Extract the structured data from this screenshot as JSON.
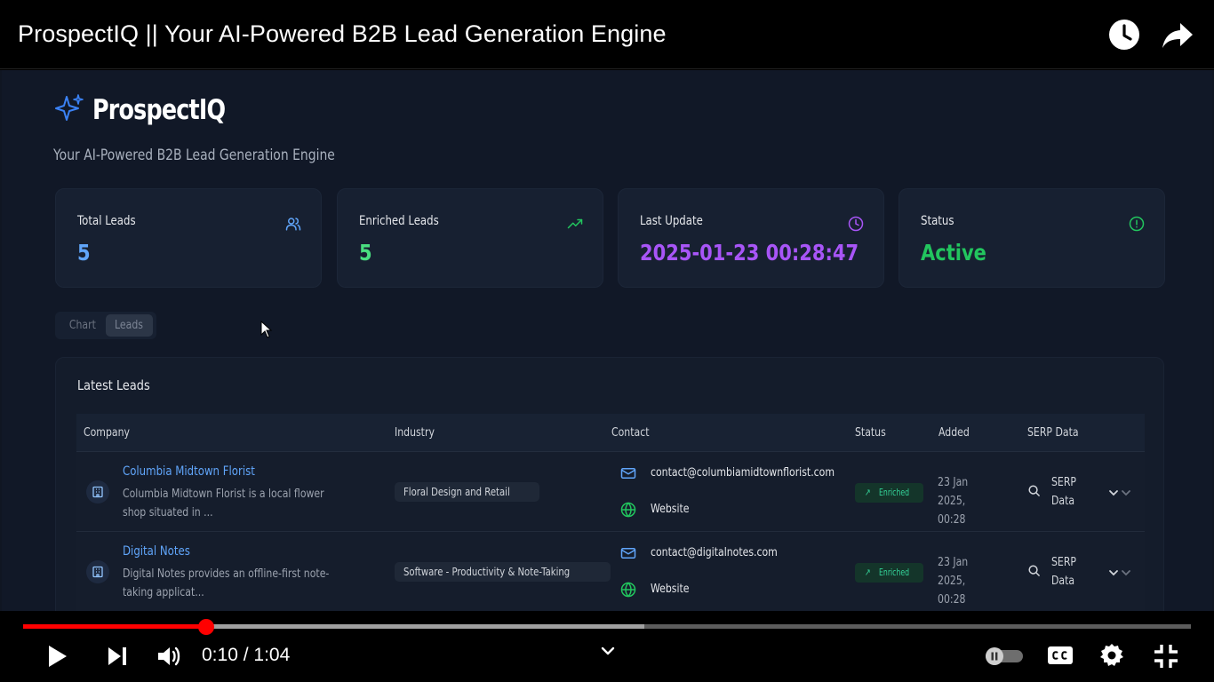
{
  "video": {
    "title": "ProspectIQ || Your AI-Powered B2B Lead Generation Engine",
    "time_current": "0:10",
    "time_separator": " / ",
    "time_total": "1:04",
    "progress_played_fraction": 0.157,
    "progress_buffered_fraction": 0.532
  },
  "app": {
    "brand": "ProspectIQ",
    "tagline": "Your AI-Powered B2B Lead Generation Engine",
    "stats": [
      {
        "label": "Total Leads",
        "value": "5",
        "color": "#60a5fa",
        "icon": "users-icon"
      },
      {
        "label": "Enriched Leads",
        "value": "5",
        "color": "#4ade80",
        "icon": "trending-up-icon"
      },
      {
        "label": "Last Update",
        "value": "2025-01-23 00:28:47",
        "color": "#a855f7",
        "icon": "clock-icon"
      },
      {
        "label": "Status",
        "value": "Active",
        "color": "#22c55e",
        "icon": "alert-circle-icon"
      }
    ],
    "tabs": [
      {
        "label": "Chart",
        "active": false
      },
      {
        "label": "Leads",
        "active": true
      }
    ],
    "leads": {
      "title": "Latest Leads",
      "columns": [
        "Company",
        "Industry",
        "Contact",
        "Status",
        "Added",
        "SERP Data"
      ],
      "rows": [
        {
          "company": "Columbia Midtown Florist",
          "description": "Columbia Midtown Florist is a local flower shop situated in ...",
          "industry": "Floral Design and Retail",
          "email": "contact@columbiamidtownflorist.com",
          "website": "Website",
          "status": "Enriched",
          "added": "23 Jan 2025, 00:28",
          "serp": "SERP Data"
        },
        {
          "company": "Digital Notes",
          "description": "Digital Notes provides an offline-first note-taking applicat...",
          "industry": "Software - Productivity & Note-Taking",
          "email": "contact@digitalnotes.com",
          "website": "Website",
          "status": "Enriched",
          "added": "23 Jan 2025, 00:28",
          "serp": "SERP Data"
        }
      ]
    }
  }
}
